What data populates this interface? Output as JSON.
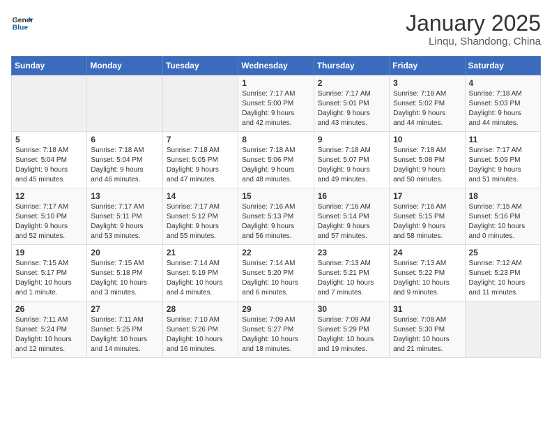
{
  "header": {
    "logo_general": "General",
    "logo_blue": "Blue",
    "title": "January 2025",
    "subtitle": "Linqu, Shandong, China"
  },
  "weekdays": [
    "Sunday",
    "Monday",
    "Tuesday",
    "Wednesday",
    "Thursday",
    "Friday",
    "Saturday"
  ],
  "weeks": [
    [
      {
        "day": "",
        "info": ""
      },
      {
        "day": "",
        "info": ""
      },
      {
        "day": "",
        "info": ""
      },
      {
        "day": "1",
        "info": "Sunrise: 7:17 AM\nSunset: 5:00 PM\nDaylight: 9 hours\nand 42 minutes."
      },
      {
        "day": "2",
        "info": "Sunrise: 7:17 AM\nSunset: 5:01 PM\nDaylight: 9 hours\nand 43 minutes."
      },
      {
        "day": "3",
        "info": "Sunrise: 7:18 AM\nSunset: 5:02 PM\nDaylight: 9 hours\nand 44 minutes."
      },
      {
        "day": "4",
        "info": "Sunrise: 7:18 AM\nSunset: 5:03 PM\nDaylight: 9 hours\nand 44 minutes."
      }
    ],
    [
      {
        "day": "5",
        "info": "Sunrise: 7:18 AM\nSunset: 5:04 PM\nDaylight: 9 hours\nand 45 minutes."
      },
      {
        "day": "6",
        "info": "Sunrise: 7:18 AM\nSunset: 5:04 PM\nDaylight: 9 hours\nand 46 minutes."
      },
      {
        "day": "7",
        "info": "Sunrise: 7:18 AM\nSunset: 5:05 PM\nDaylight: 9 hours\nand 47 minutes."
      },
      {
        "day": "8",
        "info": "Sunrise: 7:18 AM\nSunset: 5:06 PM\nDaylight: 9 hours\nand 48 minutes."
      },
      {
        "day": "9",
        "info": "Sunrise: 7:18 AM\nSunset: 5:07 PM\nDaylight: 9 hours\nand 49 minutes."
      },
      {
        "day": "10",
        "info": "Sunrise: 7:18 AM\nSunset: 5:08 PM\nDaylight: 9 hours\nand 50 minutes."
      },
      {
        "day": "11",
        "info": "Sunrise: 7:17 AM\nSunset: 5:09 PM\nDaylight: 9 hours\nand 51 minutes."
      }
    ],
    [
      {
        "day": "12",
        "info": "Sunrise: 7:17 AM\nSunset: 5:10 PM\nDaylight: 9 hours\nand 52 minutes."
      },
      {
        "day": "13",
        "info": "Sunrise: 7:17 AM\nSunset: 5:11 PM\nDaylight: 9 hours\nand 53 minutes."
      },
      {
        "day": "14",
        "info": "Sunrise: 7:17 AM\nSunset: 5:12 PM\nDaylight: 9 hours\nand 55 minutes."
      },
      {
        "day": "15",
        "info": "Sunrise: 7:16 AM\nSunset: 5:13 PM\nDaylight: 9 hours\nand 56 minutes."
      },
      {
        "day": "16",
        "info": "Sunrise: 7:16 AM\nSunset: 5:14 PM\nDaylight: 9 hours\nand 57 minutes."
      },
      {
        "day": "17",
        "info": "Sunrise: 7:16 AM\nSunset: 5:15 PM\nDaylight: 9 hours\nand 58 minutes."
      },
      {
        "day": "18",
        "info": "Sunrise: 7:15 AM\nSunset: 5:16 PM\nDaylight: 10 hours\nand 0 minutes."
      }
    ],
    [
      {
        "day": "19",
        "info": "Sunrise: 7:15 AM\nSunset: 5:17 PM\nDaylight: 10 hours\nand 1 minute."
      },
      {
        "day": "20",
        "info": "Sunrise: 7:15 AM\nSunset: 5:18 PM\nDaylight: 10 hours\nand 3 minutes."
      },
      {
        "day": "21",
        "info": "Sunrise: 7:14 AM\nSunset: 5:19 PM\nDaylight: 10 hours\nand 4 minutes."
      },
      {
        "day": "22",
        "info": "Sunrise: 7:14 AM\nSunset: 5:20 PM\nDaylight: 10 hours\nand 6 minutes."
      },
      {
        "day": "23",
        "info": "Sunrise: 7:13 AM\nSunset: 5:21 PM\nDaylight: 10 hours\nand 7 minutes."
      },
      {
        "day": "24",
        "info": "Sunrise: 7:13 AM\nSunset: 5:22 PM\nDaylight: 10 hours\nand 9 minutes."
      },
      {
        "day": "25",
        "info": "Sunrise: 7:12 AM\nSunset: 5:23 PM\nDaylight: 10 hours\nand 11 minutes."
      }
    ],
    [
      {
        "day": "26",
        "info": "Sunrise: 7:11 AM\nSunset: 5:24 PM\nDaylight: 10 hours\nand 12 minutes."
      },
      {
        "day": "27",
        "info": "Sunrise: 7:11 AM\nSunset: 5:25 PM\nDaylight: 10 hours\nand 14 minutes."
      },
      {
        "day": "28",
        "info": "Sunrise: 7:10 AM\nSunset: 5:26 PM\nDaylight: 10 hours\nand 16 minutes."
      },
      {
        "day": "29",
        "info": "Sunrise: 7:09 AM\nSunset: 5:27 PM\nDaylight: 10 hours\nand 18 minutes."
      },
      {
        "day": "30",
        "info": "Sunrise: 7:09 AM\nSunset: 5:29 PM\nDaylight: 10 hours\nand 19 minutes."
      },
      {
        "day": "31",
        "info": "Sunrise: 7:08 AM\nSunset: 5:30 PM\nDaylight: 10 hours\nand 21 minutes."
      },
      {
        "day": "",
        "info": ""
      }
    ]
  ]
}
